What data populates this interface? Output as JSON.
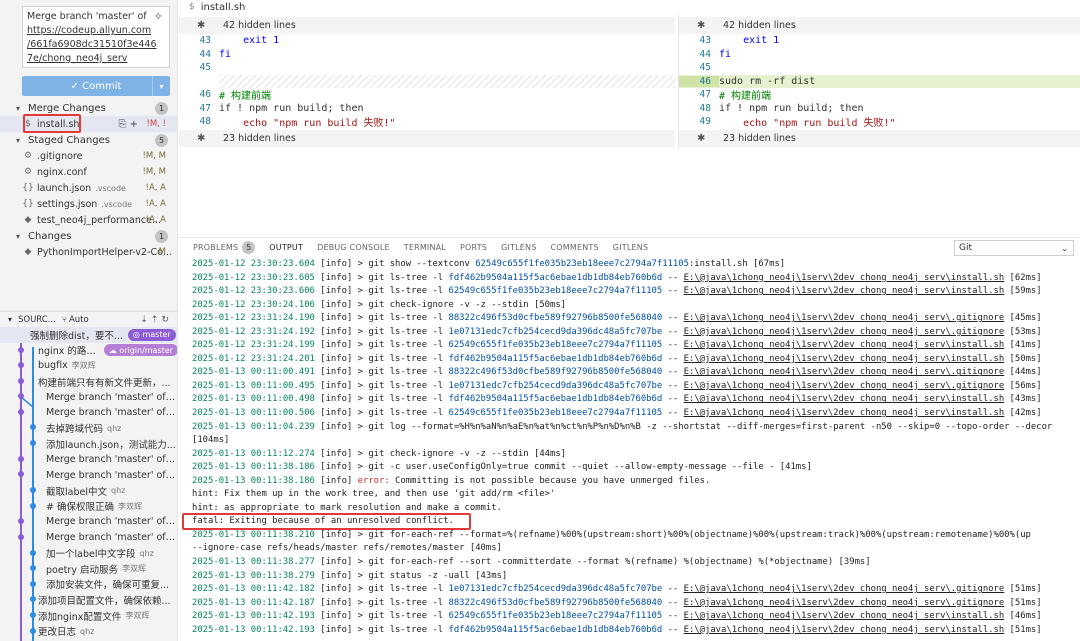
{
  "scm": {
    "commit_message_lines": [
      "Merge branch 'master' of",
      "https://codeup.aliyun.com",
      "/661fa6908dc31510f3e446",
      "7e/chong_neo4j_serv"
    ],
    "commit_button": "✓ Commit",
    "merge_changes": {
      "label": "Merge Changes",
      "count": "1"
    },
    "merge_files": [
      {
        "name": "install.sh",
        "status": "!M, !"
      }
    ],
    "staged_changes": {
      "label": "Staged Changes",
      "count": "5"
    },
    "staged_files": [
      {
        "name": ".gitignore",
        "dir": "",
        "status": "!M, M"
      },
      {
        "name": "nginx.conf",
        "dir": "",
        "status": "!M, M"
      },
      {
        "name": "launch.json",
        "dir": ".vscode",
        "status": "!A, A"
      },
      {
        "name": "settings.json",
        "dir": ".vscode",
        "status": "!A, A"
      },
      {
        "name": "test_neo4j_performance...",
        "dir": "",
        "status": "!A, A"
      }
    ],
    "changes": {
      "label": "Changes",
      "count": "1"
    },
    "change_files": [
      {
        "name": "PythonImportHelper-v2-Co...",
        "status": "M"
      }
    ]
  },
  "graph": {
    "header": "SOURC...",
    "auto": "Auto",
    "rows": [
      {
        "msg": "强制删除dist，要不...",
        "author": "",
        "tag": "master"
      },
      {
        "msg": "nginx 的路径...",
        "author": "",
        "tag": "origin/master"
      },
      {
        "msg": "bugfix",
        "author": "李双辉",
        "tag": ""
      },
      {
        "msg": "构建前端只有有新文件更新，...",
        "author": "",
        "tag": ""
      },
      {
        "msg": "Merge branch 'master' of c...",
        "author": "",
        "tag": ""
      },
      {
        "msg": "Merge branch 'master' of ht...",
        "author": "",
        "tag": ""
      },
      {
        "msg": "去掉跨域代码",
        "author": "qhz",
        "tag": ""
      },
      {
        "msg": "添加launch.json，测试能力...",
        "author": "",
        "tag": ""
      },
      {
        "msg": "Merge branch 'master' of c...",
        "author": "",
        "tag": ""
      },
      {
        "msg": "Merge branch 'master' of ht...",
        "author": "",
        "tag": ""
      },
      {
        "msg": "截取label中文",
        "author": "qhz",
        "tag": ""
      },
      {
        "msg": "# 确保权限正确",
        "author": "李双辉",
        "tag": ""
      },
      {
        "msg": "Merge branch 'master' of c...",
        "author": "",
        "tag": ""
      },
      {
        "msg": "Merge branch 'master' of ht...",
        "author": "",
        "tag": ""
      },
      {
        "msg": "加一个label中文字段",
        "author": "qhz",
        "tag": ""
      },
      {
        "msg": "poetry 启动服务",
        "author": "李双辉",
        "tag": ""
      },
      {
        "msg": "添加安装文件，确保可重复...",
        "author": "",
        "tag": ""
      },
      {
        "msg": "添加项目配置文件，确保依赖...",
        "author": "",
        "tag": ""
      },
      {
        "msg": "添加nginx配置文件",
        "author": "李双辉",
        "tag": ""
      },
      {
        "msg": "更改日志",
        "author": "qhz",
        "tag": ""
      }
    ]
  },
  "editor": {
    "tab": "install.sh",
    "left": {
      "hidden_top": "42 hidden lines",
      "hidden_bottom": "23 hidden lines",
      "lines": [
        {
          "n": "43",
          "text": "    exit 1"
        },
        {
          "n": "44",
          "text": "fi"
        },
        {
          "n": "45",
          "text": ""
        },
        {
          "n": "",
          "text": ""
        },
        {
          "n": "46",
          "text": "# 构建前端"
        },
        {
          "n": "47",
          "text": "if ! npm run build; then"
        },
        {
          "n": "48",
          "text": "    echo \"npm run build 失败!\""
        }
      ]
    },
    "right": {
      "hidden_top": "42 hidden lines",
      "hidden_bottom": "23 hidden lines",
      "lines": [
        {
          "n": "43",
          "text": "    exit 1"
        },
        {
          "n": "44",
          "text": "fi"
        },
        {
          "n": "45",
          "text": ""
        },
        {
          "n": "46",
          "text": "sudo rm -rf dist"
        },
        {
          "n": "47",
          "text": "# 构建前端"
        },
        {
          "n": "48",
          "text": "if ! npm run build; then"
        },
        {
          "n": "49",
          "text": "    echo \"npm run build 失败!\""
        }
      ]
    }
  },
  "panel": {
    "tabs": [
      "PROBLEMS",
      "OUTPUT",
      "DEBUG CONSOLE",
      "TERMINAL",
      "PORTS",
      "GITLENS",
      "COMMENTS",
      "GITLENS"
    ],
    "problems_count": "5",
    "active_tab": "OUTPUT",
    "output_channel": "Git"
  },
  "log": [
    "2025-01-12 23:30:23.604 [info] > git show --textconv 62549c655f1fe035b23eb18eee7c2794a7f11105:install.sh [67ms]",
    "2025-01-12 23:30:23.605 [info] > git ls-tree -l fdf462b9504a115f5ac6ebae1db1db84eb760b6d -- E:\\@java\\1chong_neo4j\\1serv\\2dev_chong_neo4j_serv\\install.sh [62ms]",
    "2025-01-12 23:30:23.606 [info] > git ls-tree -l 62549c655f1fe035b23eb18eee7c2794a7f11105 -- E:\\@java\\1chong_neo4j\\1serv\\2dev_chong_neo4j_serv\\install.sh [59ms]",
    "2025-01-12 23:30:24.106 [info] > git check-ignore -v -z --stdin [50ms]",
    "2025-01-12 23:31:24.190 [info] > git ls-tree -l 88322c496f53d0cfbe589f92796b8500fe568040 -- E:\\@java\\1chong_neo4j\\1serv\\2dev_chong_neo4j_serv\\.gitignore [45ms]",
    "2025-01-12 23:31:24.192 [info] > git ls-tree -l 1e07131edc7cfb254cecd9da396dc48a5fc707be -- E:\\@java\\1chong_neo4j\\1serv\\2dev_chong_neo4j_serv\\.gitignore [53ms]",
    "2025-01-12 23:31:24.199 [info] > git ls-tree -l 62549c655f1fe035b23eb18eee7c2794a7f11105 -- E:\\@java\\1chong_neo4j\\1serv\\2dev_chong_neo4j_serv\\install.sh [41ms]",
    "2025-01-12 23:31:24.201 [info] > git ls-tree -l fdf462b9504a115f5ac6ebae1db1db84eb760b6d -- E:\\@java\\1chong_neo4j\\1serv\\2dev_chong_neo4j_serv\\install.sh [50ms]",
    "2025-01-13 00:11:00.491 [info] > git ls-tree -l 88322c496f53d0cfbe589f92796b8500fe568040 -- E:\\@java\\1chong_neo4j\\1serv\\2dev_chong_neo4j_serv\\.gitignore [44ms]",
    "2025-01-13 00:11:00.495 [info] > git ls-tree -l 1e07131edc7cfb254cecd9da396dc48a5fc707be -- E:\\@java\\1chong_neo4j\\1serv\\2dev_chong_neo4j_serv\\.gitignore [56ms]",
    "2025-01-13 00:11:00.498 [info] > git ls-tree -l fdf462b9504a115f5ac6ebae1db1db84eb760b6d -- E:\\@java\\1chong_neo4j\\1serv\\2dev_chong_neo4j_serv\\install.sh [43ms]",
    "2025-01-13 00:11:00.506 [info] > git ls-tree -l 62549c655f1fe035b23eb18eee7c2794a7f11105 -- E:\\@java\\1chong_neo4j\\1serv\\2dev_chong_neo4j_serv\\install.sh [42ms]",
    "2025-01-13 00:11:04.239 [info] > git log --format=%H%n%aN%n%aE%n%at%n%ct%n%P%n%D%n%B -z --shortstat --diff-merges=first-parent -n50 --skip=0 --topo-order --decor",
    "[104ms]",
    "2025-01-13 00:11:12.274 [info] > git check-ignore -v -z --stdin [44ms]",
    "2025-01-13 00:11:38.186 [info] > git -c user.useConfigOnly=true commit --quiet --allow-empty-message --file - [41ms]",
    "2025-01-13 00:11:38.186 [info] error: Committing is not possible because you have unmerged files.",
    "hint: Fix them up in the work tree, and then use 'git add/rm <file>'",
    "hint: as appropriate to mark resolution and make a commit.",
    "fatal: Exiting because of an unresolved conflict.",
    "2025-01-13 00:11:38.210 [info] > git for-each-ref --format=%(refname)%00%(upstream:short)%00%(objectname)%00%(upstream:track)%00%(upstream:remotename)%00%(up",
    "--ignore-case refs/heads/master refs/remotes/master [40ms]",
    "2025-01-13 00:11:38.277 [info] > git for-each-ref --sort -committerdate --format %(refname) %(objectname) %(*objectname) [39ms]",
    "2025-01-13 00:11:38.279 [info] > git status -z -uall [43ms]",
    "2025-01-13 00:11:42.182 [info] > git ls-tree -l 1e07131edc7cfb254cecd9da396dc48a5fc707be -- E:\\@java\\1chong_neo4j\\1serv\\2dev_chong_neo4j_serv\\.gitignore [51ms]",
    "2025-01-13 00:11:42.187 [info] > git ls-tree -l 88322c496f53d0cfbe589f92796b8500fe568040 -- E:\\@java\\1chong_neo4j\\1serv\\2dev_chong_neo4j_serv\\.gitignore [51ms]",
    "2025-01-13 00:11:42.193 [info] > git ls-tree -l 62549c655f1fe035b23eb18eee7c2794a7f11105 -- E:\\@java\\1chong_neo4j\\1serv\\2dev_chong_neo4j_serv\\install.sh [46ms]",
    "2025-01-13 00:11:42.193 [info] > git ls-tree -l fdf462b9504a115f5ac6ebae1db1db84eb760b6d -- E:\\@java\\1chong_neo4j\\1serv\\2dev_chong_neo4j_serv\\install.sh [51ms]"
  ],
  "colors": {
    "accent": "#8b5cd6",
    "highlight_red": "#e23a3a",
    "added_line": "#e6f2cf"
  }
}
